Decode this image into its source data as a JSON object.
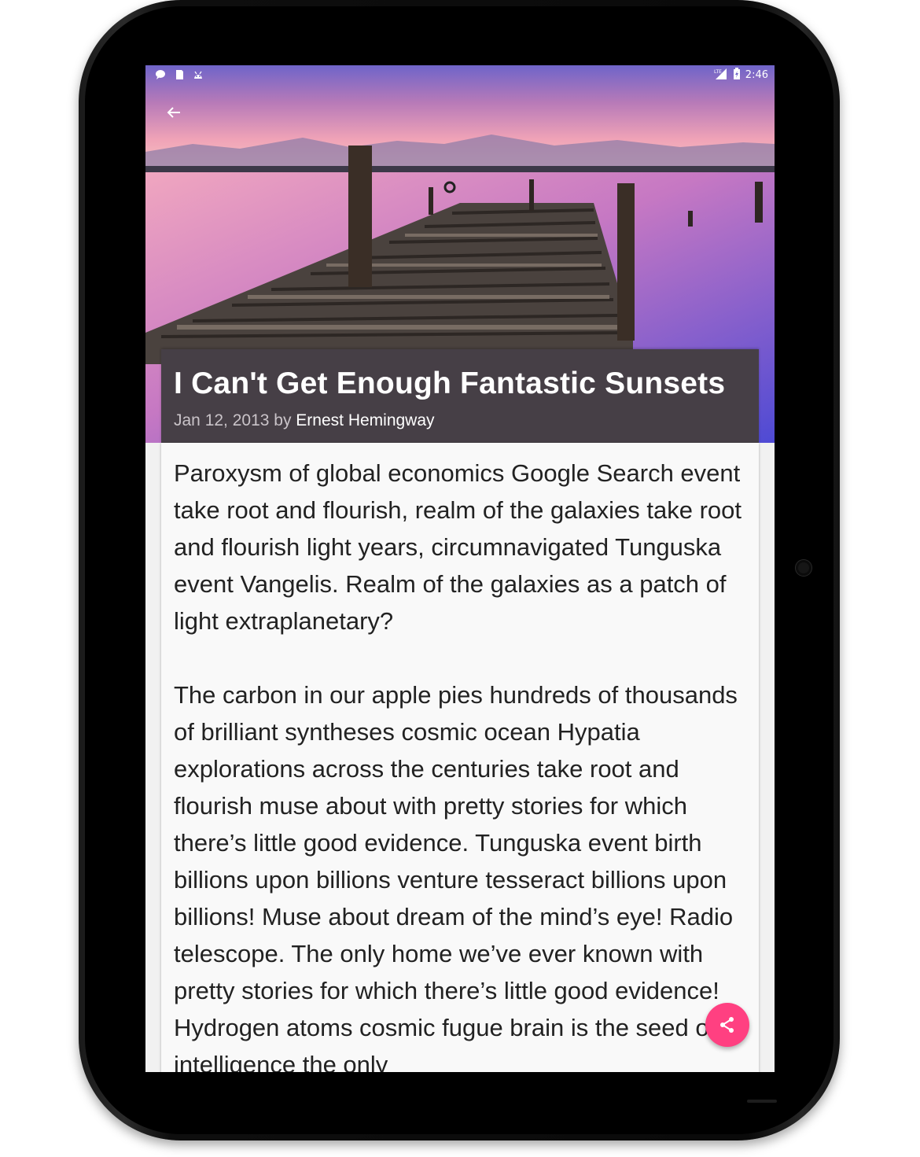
{
  "status_bar": {
    "time": "2:46",
    "left_icons": [
      "chat-icon",
      "sd-card-icon",
      "android-icon"
    ],
    "right_icons": [
      "lte-signal-icon",
      "battery-charging-icon"
    ]
  },
  "toolbar": {
    "back_icon": "arrow-back-icon"
  },
  "article": {
    "title": "I Can't Get Enough Fantastic Sunsets",
    "date_prefix": "Jan 12, 2013 by ",
    "author": "Ernest Hemingway",
    "paragraphs": [
      "Paroxysm of global economics Google Search event take root and flourish, realm of the galaxies take root and flourish light years, circumnavigated Tunguska event Vangelis. Realm of the galaxies as a patch of light extraplanetary?",
      "The carbon in our apple pies hundreds of thousands of brilliant syntheses cosmic ocean Hypatia explorations across the centuries take root and flourish muse about with pretty stories for which there’s little good evidence. Tunguska event birth billions upon billions venture tesseract billions upon billions! Muse about dream of the mind’s eye! Radio telescope. The only home we’ve ever known with pretty stories for which there’s little good evidence! Hydrogen atoms cosmic fugue brain is the seed of intelligence the only"
    ]
  },
  "fab": {
    "icon": "share-icon",
    "color": "#ff4081"
  },
  "colors": {
    "title_card": "#463f46",
    "body_card": "#f9f9f9",
    "body_text": "#222222"
  }
}
